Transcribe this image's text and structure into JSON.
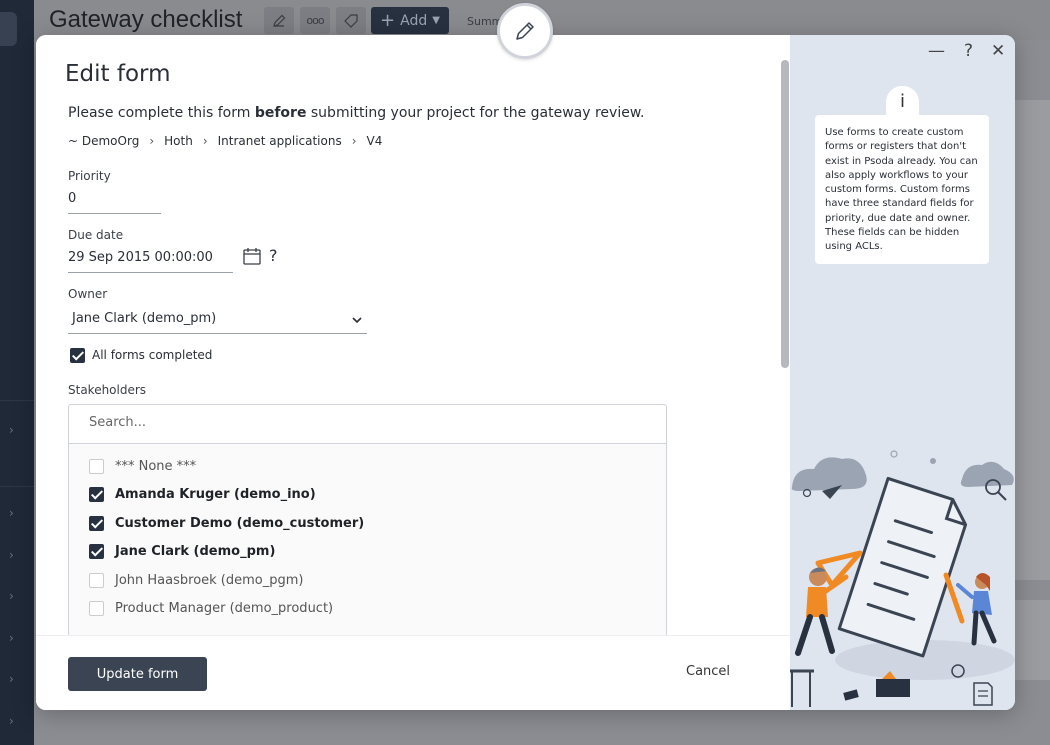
{
  "background": {
    "page_title": "Gateway checklist",
    "add_label": "Add",
    "summary_label": "Summa"
  },
  "modal": {
    "title": "Edit form",
    "intro_pre": "Please complete this form ",
    "intro_bold": "before",
    "intro_post": " submitting your project for the gateway review.",
    "breadcrumb": [
      "~ DemoOrg",
      "Hoth",
      "Intranet applications",
      "V4"
    ],
    "priority": {
      "label": "Priority",
      "value": "0"
    },
    "due_date": {
      "label": "Due date",
      "value": "29 Sep 2015 00:00:00",
      "help": "?"
    },
    "owner": {
      "label": "Owner",
      "value": "Jane Clark (demo_pm)"
    },
    "all_forms": {
      "label": "All forms completed",
      "checked": true
    },
    "stakeholders": {
      "label": "Stakeholders",
      "search_placeholder": "Search...",
      "items": [
        {
          "label": "*** None ***",
          "checked": false
        },
        {
          "label": "Amanda Kruger (demo_ino)",
          "checked": true
        },
        {
          "label": "Customer Demo (demo_customer)",
          "checked": true
        },
        {
          "label": "Jane Clark (demo_pm)",
          "checked": true
        },
        {
          "label": "John Haasbroek (demo_pgm)",
          "checked": false
        },
        {
          "label": "Product Manager (demo_product)",
          "checked": false
        }
      ]
    },
    "update_label": "Update form",
    "cancel_label": "Cancel"
  },
  "side": {
    "controls": {
      "minimize": "—",
      "help": "?",
      "close": "✕"
    },
    "info_icon": "i",
    "info_text": "Use forms to create custom forms or registers that don't exist in Psoda already. You can also apply workflows to your custom forms. Custom forms have three standard fields for priority, due date and owner. These fields can be hidden using ACLs."
  },
  "colors": {
    "primary": "#273140",
    "side_panel": "#dfe5ef",
    "illustration_accent": "#f08a24"
  }
}
